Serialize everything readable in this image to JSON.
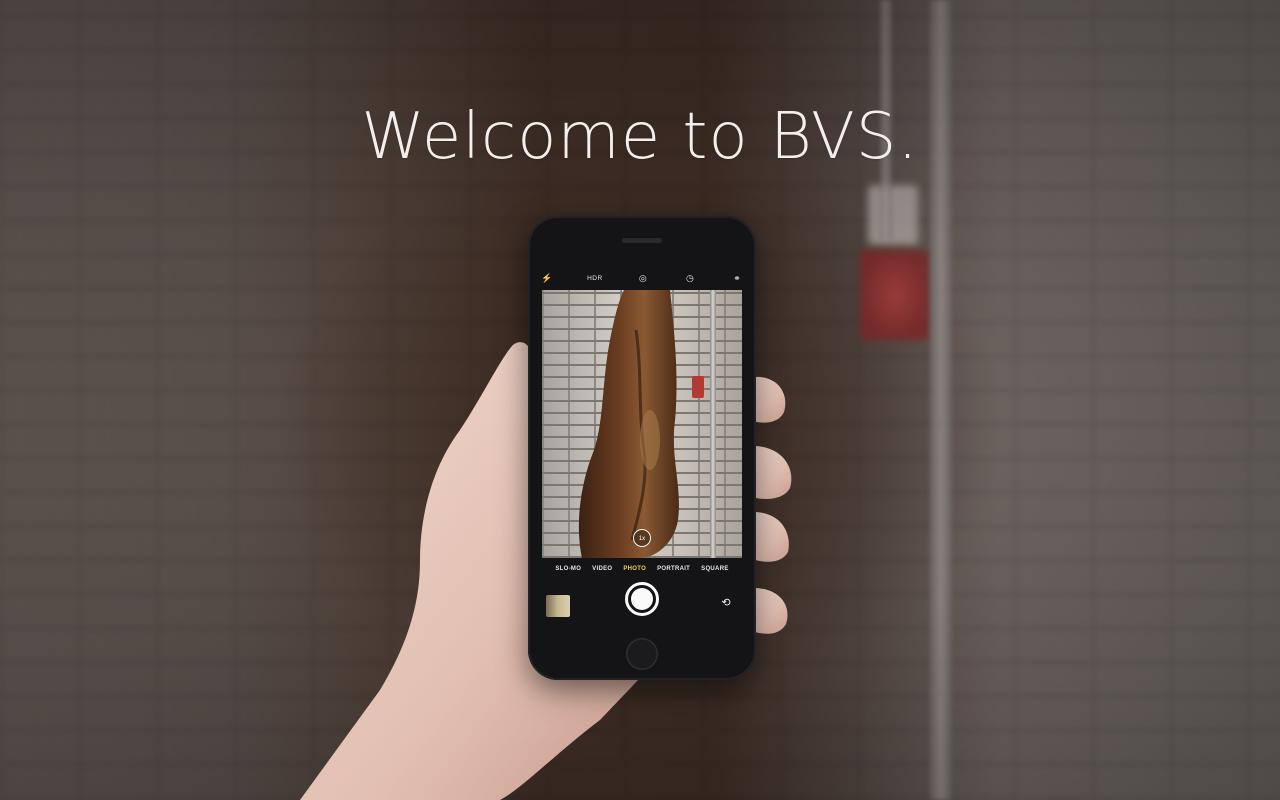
{
  "headline": "Welcome to BVS.",
  "camera": {
    "top_icons": {
      "flash": "flash-icon",
      "hdr_label": "HDR",
      "live": "live-photo-icon",
      "timer": "timer-icon",
      "filters": "filters-icon"
    },
    "zoom_label": "1x",
    "modes": [
      "SLO-MO",
      "VIDEO",
      "PHOTO",
      "PORTRAIT",
      "SQUARE"
    ],
    "active_mode": "PHOTO",
    "flip_icon": "camera-flip-icon"
  },
  "colors": {
    "headline": "#f3efec",
    "active_mode": "#f7d14a",
    "alarm_red": "#a63a3a"
  }
}
